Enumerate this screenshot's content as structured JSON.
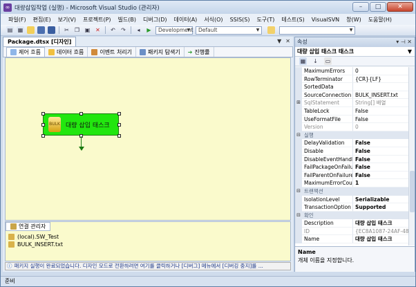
{
  "window": {
    "title": "대량삽입작업 (실행) - Microsoft Visual Studio (관리자)",
    "controls": {
      "minimize": "–",
      "maximize": "□",
      "close": "✕"
    }
  },
  "menu": [
    "파일(F)",
    "편집(E)",
    "보기(V)",
    "프로젝트(P)",
    "빌드(B)",
    "디버그(D)",
    "데이터(A)",
    "서식(O)",
    "SSIS(S)",
    "도구(T)",
    "테스트(S)",
    "VisualSVN",
    "창(W)",
    "도움말(H)"
  ],
  "toolbar": {
    "solution_config": "Development",
    "platform": "Default"
  },
  "document": {
    "tab": "Package.dtsx [디자인]",
    "tabs": [
      "제어 흐름",
      "데이터 흐름",
      "이벤트 처리기",
      "패키지 탐색기",
      "진행률"
    ],
    "task_label": "대량 삽입 태스크",
    "task_icon_text": "BULK",
    "connection_manager": {
      "title": "연결 관리자",
      "items": [
        "(local).SW_Test",
        "BULK_INSERT.txt"
      ]
    },
    "infobar": "패키지 실행이 완료되었습니다. 디자인 모드로 전환하려면 여기를 클릭하거나 [디버그] 메뉴에서 [디버깅 중지]를 ..."
  },
  "properties": {
    "title": "속성",
    "object": "대량 삽입 태스크 태스크",
    "rows": [
      {
        "type": "prop",
        "name": "MaximumErrors",
        "value": "0"
      },
      {
        "type": "prop",
        "name": "RowTerminator",
        "value": "{CR}{LF}"
      },
      {
        "type": "prop",
        "name": "SortedData",
        "value": ""
      },
      {
        "type": "prop",
        "name": "SourceConnection",
        "value": "BULK_INSERT.txt"
      },
      {
        "type": "prop",
        "name": "SqlStatement",
        "value": "String[] 배열",
        "dim": true,
        "expand": "⊞"
      },
      {
        "type": "prop",
        "name": "TableLock",
        "value": "False"
      },
      {
        "type": "prop",
        "name": "UseFormatFile",
        "value": "False"
      },
      {
        "type": "prop",
        "name": "Version",
        "value": "0",
        "dim": true
      },
      {
        "type": "cat",
        "name": "실행",
        "expand": "⊟"
      },
      {
        "type": "prop",
        "name": "DelayValidation",
        "value": "False",
        "bold": true
      },
      {
        "type": "prop",
        "name": "Disable",
        "value": "False",
        "bold": true
      },
      {
        "type": "prop",
        "name": "DisableEventHandlers",
        "value": "False",
        "bold": true
      },
      {
        "type": "prop",
        "name": "FailPackageOnFailure",
        "value": "False",
        "bold": true
      },
      {
        "type": "prop",
        "name": "FailParentOnFailure",
        "value": "False",
        "bold": true
      },
      {
        "type": "prop",
        "name": "MaximumErrorCount",
        "value": "1",
        "bold": true
      },
      {
        "type": "cat",
        "name": "트랜잭션",
        "expand": "⊟"
      },
      {
        "type": "prop",
        "name": "IsolationLevel",
        "value": "Serializable",
        "bold": true
      },
      {
        "type": "prop",
        "name": "TransactionOption",
        "value": "Supported",
        "bold": true
      },
      {
        "type": "cat",
        "name": "확인",
        "expand": "⊟"
      },
      {
        "type": "prop",
        "name": "Description",
        "value": "대량 삽입 태스크",
        "bold": true
      },
      {
        "type": "prop",
        "name": "ID",
        "value": "{EC8A1087-24AF-48D",
        "dim": true
      },
      {
        "type": "prop",
        "name": "Name",
        "value": "대량 삽입 태스크",
        "bold": true
      }
    ],
    "desc_name": "Name",
    "desc_text": "개체 이름을 지정합니다."
  },
  "status": "준비",
  "colors": {
    "task_fill": "#22e60f",
    "canvas": "#fafacc"
  }
}
